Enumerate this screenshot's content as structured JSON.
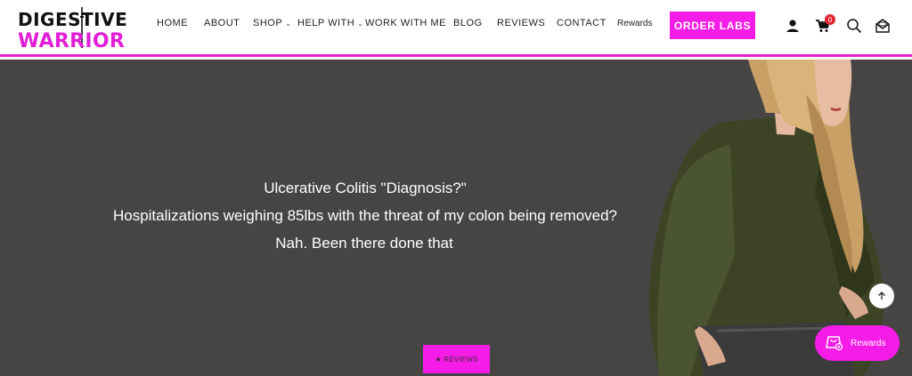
{
  "logo": {
    "line1": "DIGESTIVE",
    "line2": "WARRIOR",
    "accent": "#e21fd6"
  },
  "nav": {
    "home": "HOME",
    "about": "ABOUT",
    "shop": "SHOP",
    "help_with": "HELP WITH",
    "work_with_me": "WORK WITH ME",
    "blog": "BLOG",
    "reviews": "REVIEWS",
    "contact": "CONTACT",
    "rewards": "Rewards"
  },
  "order_labs": "ORDER LABS",
  "icons": {
    "account": "user-icon",
    "cart": "cart-icon",
    "search": "search-icon",
    "mail": "mail-icon",
    "dropdown": "chevron-down-icon",
    "scroll_top": "arrow-up-icon",
    "rewards": "gift-icon"
  },
  "cart_count": "0",
  "hero": {
    "line1": "Ulcerative Colitis \"Diagnosis?\"",
    "line2": "Hospitalizations weighing 85lbs with the threat of my colon being removed?",
    "line3": "Nah. Been there done that",
    "reviews_button": "★ REVIEWS",
    "background": "#474544"
  },
  "rewards_launcher": "Rewards",
  "colors": {
    "magenta": "#f51ce7",
    "badge_red": "#e3262f"
  }
}
